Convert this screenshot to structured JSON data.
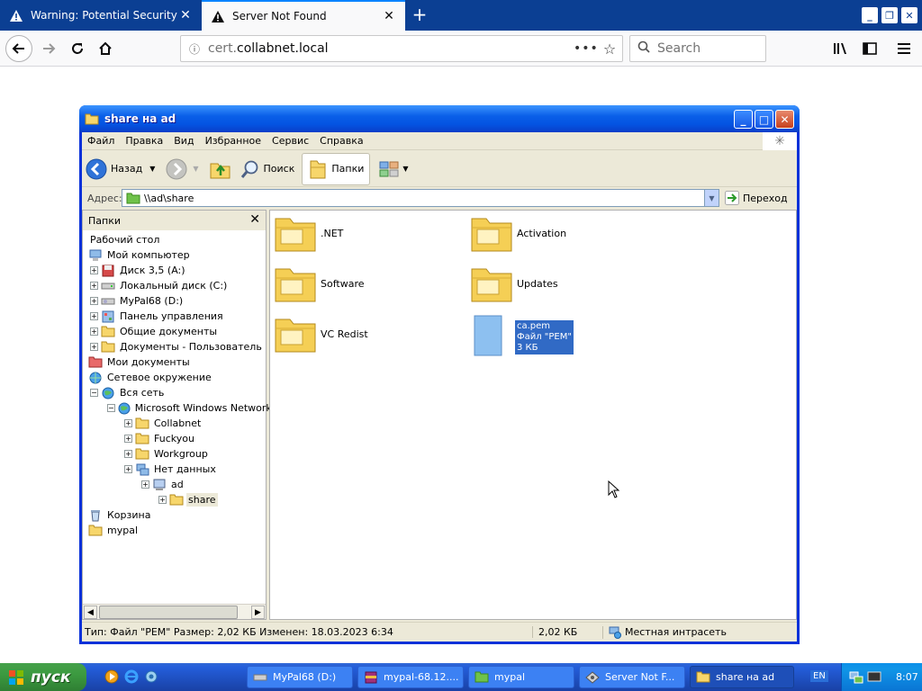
{
  "browser": {
    "tabs": [
      {
        "title": "Warning: Potential Security Risk Ahead",
        "active": false
      },
      {
        "title": "Server Not Found",
        "active": true
      }
    ],
    "url_prefix": "cert.",
    "url_host": "collabnet.local",
    "search_placeholder": "Search"
  },
  "explorer": {
    "title": "share на ad",
    "menu": [
      "Файл",
      "Правка",
      "Вид",
      "Избранное",
      "Сервис",
      "Справка"
    ],
    "toolbar": {
      "back": "Назад",
      "search": "Поиск",
      "folders": "Папки"
    },
    "address": {
      "label": "Адрес:",
      "value": "\\\\ad\\share",
      "go": "Переход"
    },
    "folders_pane": {
      "title": "Папки",
      "tree": [
        {
          "label": "Рабочий стол",
          "icon": "desktop-icon"
        },
        {
          "label": "Мой компьютер",
          "icon": "computer-icon"
        },
        {
          "label": "Диск 3,5 (A:)",
          "icon": "floppy-icon"
        },
        {
          "label": "Локальный диск (C:)",
          "icon": "drive-icon"
        },
        {
          "label": "MyPal68 (D:)",
          "icon": "cd-drive-icon"
        },
        {
          "label": "Панель управления",
          "icon": "control-panel-icon"
        },
        {
          "label": "Общие документы",
          "icon": "folder-icon"
        },
        {
          "label": "Документы - Пользователь",
          "icon": "folder-icon"
        },
        {
          "label": "Мои документы",
          "icon": "my-documents-icon"
        },
        {
          "label": "Сетевое окружение",
          "icon": "network-icon"
        },
        {
          "label": "Вся сеть",
          "icon": "globe-icon"
        },
        {
          "label": "Microsoft Windows Network",
          "icon": "globe-icon"
        },
        {
          "label": "Collabnet",
          "icon": "folder-icon"
        },
        {
          "label": "Fuckyou",
          "icon": "folder-icon"
        },
        {
          "label": "Workgroup",
          "icon": "folder-icon"
        },
        {
          "label": "Нет данных",
          "icon": "network-icon"
        },
        {
          "label": "ad",
          "icon": "server-icon"
        },
        {
          "label": "share",
          "icon": "folder-icon"
        },
        {
          "label": "Корзина",
          "icon": "recycle-bin-icon"
        },
        {
          "label": "mypal",
          "icon": "folder-icon"
        }
      ]
    },
    "items": [
      {
        "label": ".NET",
        "type": "folder"
      },
      {
        "label": "Activation",
        "type": "folder"
      },
      {
        "label": "Software",
        "type": "folder"
      },
      {
        "label": "Updates",
        "type": "folder"
      },
      {
        "label": "VC Redist",
        "type": "folder"
      }
    ],
    "selected_file": {
      "name": "ca.pem",
      "type": "Файл \"PEM\"",
      "size": "3 КБ"
    },
    "status": {
      "main": "Тип: Файл \"PEM\" Размер: 2,02 КБ Изменен: 18.03.2023 6:34",
      "size": "2,02 КБ",
      "zone": "Местная интрасеть"
    }
  },
  "taskbar": {
    "start": "пуск",
    "tasks": [
      {
        "label": "MyPal68 (D:)",
        "icon": "drive-icon"
      },
      {
        "label": "mypal-68.12....",
        "icon": "archive-icon"
      },
      {
        "label": "mypal",
        "icon": "mypal-icon"
      },
      {
        "label": "Server Not F...",
        "icon": "browser-icon"
      },
      {
        "label": "share на ad",
        "icon": "folder-icon"
      }
    ],
    "lang": "EN",
    "clock": "8:07"
  },
  "colors": {
    "firefox_tabbar": "#0b3f93",
    "xp_titlebar": "#0a5fe8",
    "xp_face": "#ece9d8",
    "selection": "#316ac5",
    "taskbar": "#245edb",
    "start": "#3c9a40"
  }
}
